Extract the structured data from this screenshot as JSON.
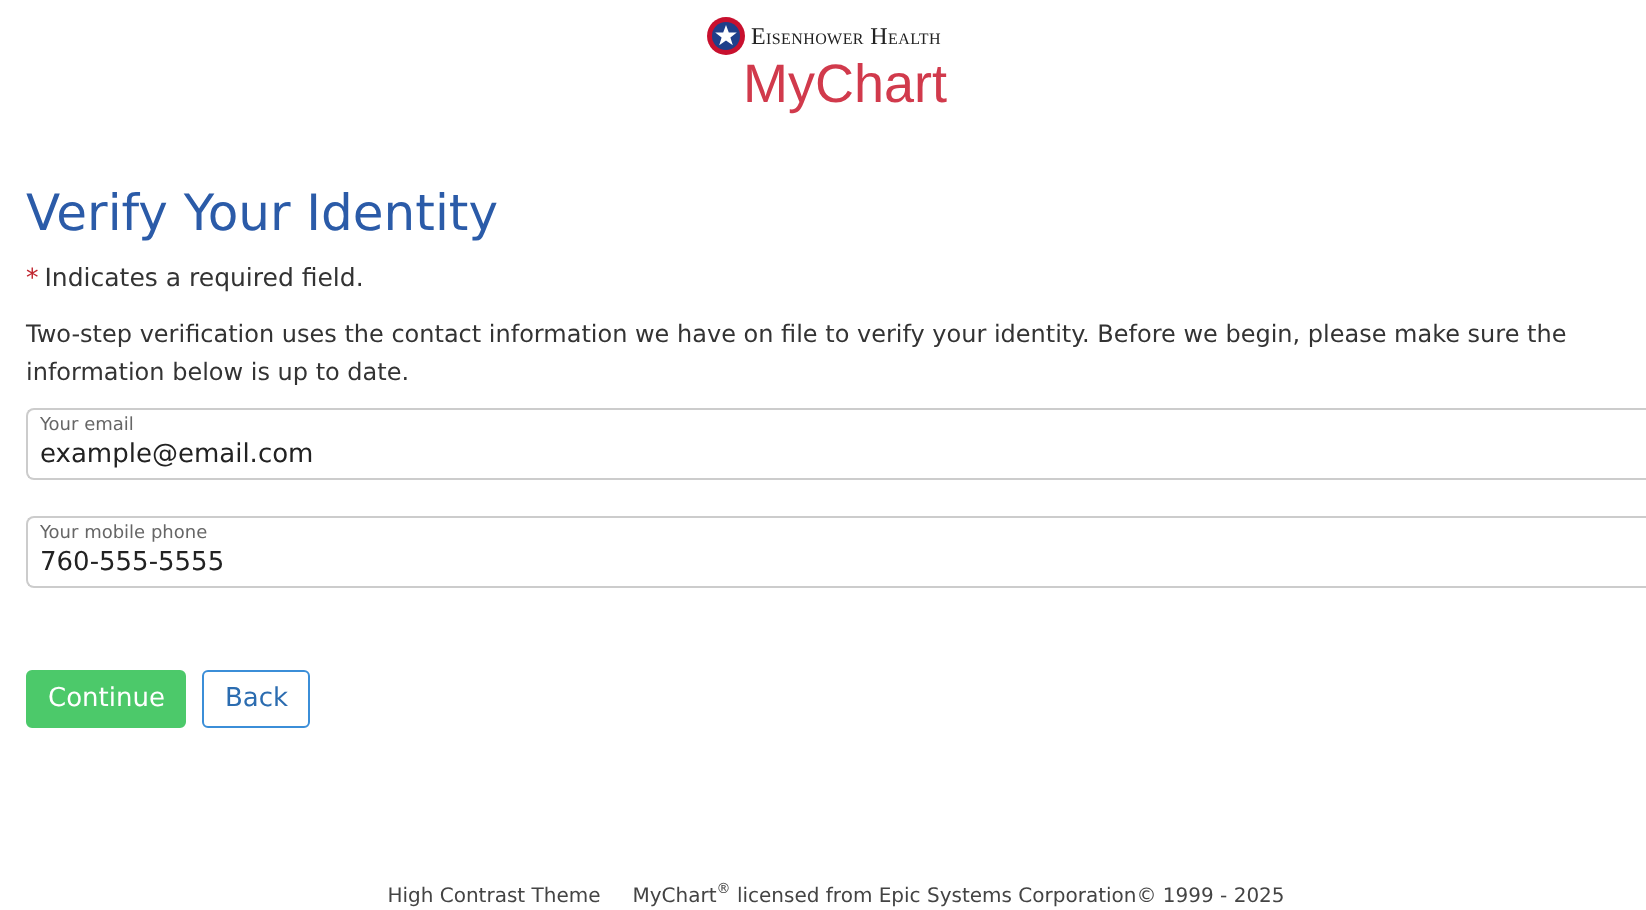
{
  "header": {
    "org_name": "Eisenhower Health",
    "product_name": "MyChart"
  },
  "page": {
    "title": "Verify Your Identity",
    "required_marker": "*",
    "required_note": "Indicates a required field.",
    "intro": "Two-step verification uses the contact information we have on file to verify your identity. Before we begin, please make sure the information below is up to date."
  },
  "fields": [
    {
      "label": "Your email",
      "value": "example@email.com"
    },
    {
      "label": "Your mobile phone",
      "value": "760-555-5555"
    }
  ],
  "buttons": [
    {
      "label": "Continue",
      "kind": "primary"
    },
    {
      "label": "Back",
      "kind": "secondary"
    }
  ],
  "footer": {
    "links": [
      "High Contrast Theme"
    ],
    "copyright": "MyChart$^{®}$ licensed from Epic Systems Corporation© 1999 - 2025"
  }
}
